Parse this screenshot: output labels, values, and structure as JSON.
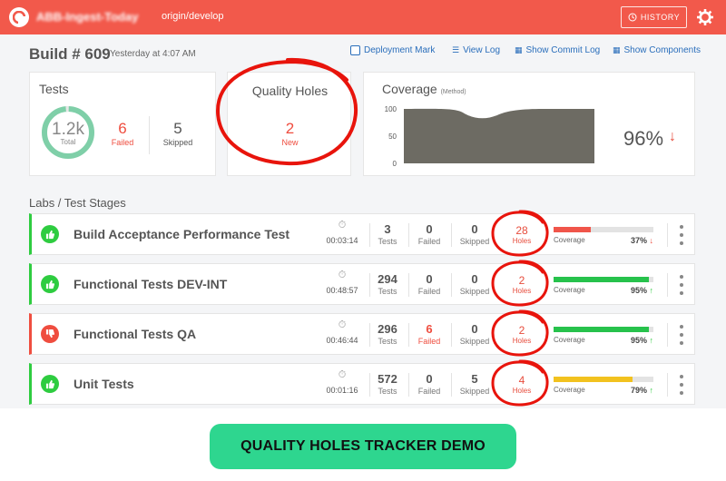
{
  "header": {
    "app_name": "ABB-Ingest-Today",
    "branch": "origin/develop",
    "history_label": "HISTORY"
  },
  "build": {
    "title": "Build # 609",
    "time": "Yesterday at 4:07 AM"
  },
  "actions": {
    "deployment_mark": "Deployment Mark",
    "view_log": "View Log",
    "show_commit_log": "Show Commit Log",
    "show_components": "Show Components"
  },
  "tests_card": {
    "title": "Tests",
    "total_value": "1.2k",
    "total_label": "Total",
    "failed_value": "6",
    "failed_label": "Failed",
    "skipped_value": "5",
    "skipped_label": "Skipped"
  },
  "quality_card": {
    "title": "Quality Holes",
    "value": "2",
    "label": "New"
  },
  "coverage_card": {
    "title": "Coverage",
    "subtitle": "(Method)",
    "percent": "96%",
    "trend": "down",
    "y_ticks": [
      "100",
      "50",
      "0"
    ]
  },
  "stages_title": "Labs / Test Stages",
  "stages": [
    {
      "name": "Build Acceptance Performance Test",
      "status": "pass",
      "duration": "00:03:14",
      "tests": "3",
      "tests_label": "Tests",
      "failed": "0",
      "failed_label": "Failed",
      "skipped": "0",
      "skipped_label": "Skipped",
      "holes": "28",
      "holes_label": "Holes",
      "coverage_label": "Coverage",
      "coverage": "37%",
      "coverage_value": 0.37,
      "coverage_color": "#f0554a",
      "trend": "down"
    },
    {
      "name": "Functional Tests DEV-INT",
      "status": "pass",
      "duration": "00:48:57",
      "tests": "294",
      "tests_label": "Tests",
      "failed": "0",
      "failed_label": "Failed",
      "skipped": "0",
      "skipped_label": "Skipped",
      "holes": "2",
      "holes_label": "Holes",
      "coverage_label": "Coverage",
      "coverage": "95%",
      "coverage_value": 0.95,
      "coverage_color": "#27c24c",
      "trend": "up"
    },
    {
      "name": "Functional Tests QA",
      "status": "fail",
      "duration": "00:46:44",
      "tests": "296",
      "tests_label": "Tests",
      "failed": "6",
      "failed_label": "Failed",
      "skipped": "0",
      "skipped_label": "Skipped",
      "holes": "2",
      "holes_label": "Holes",
      "coverage_label": "Coverage",
      "coverage": "95%",
      "coverage_value": 0.95,
      "coverage_color": "#27c24c",
      "trend": "up"
    },
    {
      "name": "Unit Tests",
      "status": "pass",
      "duration": "00:01:16",
      "tests": "572",
      "tests_label": "Tests",
      "failed": "0",
      "failed_label": "Failed",
      "skipped": "5",
      "skipped_label": "Skipped",
      "holes": "4",
      "holes_label": "Holes",
      "coverage_label": "Coverage",
      "coverage": "79%",
      "coverage_value": 0.79,
      "coverage_color": "#f2c21f",
      "trend": "up"
    }
  ],
  "banner": "QUALITY HOLES TRACKER DEMO",
  "colors": {
    "brand": "#f2594b",
    "pass": "#2ecc40",
    "fail": "#ef4d3f",
    "link": "#2a6ebb",
    "banner": "#2ed68f"
  }
}
